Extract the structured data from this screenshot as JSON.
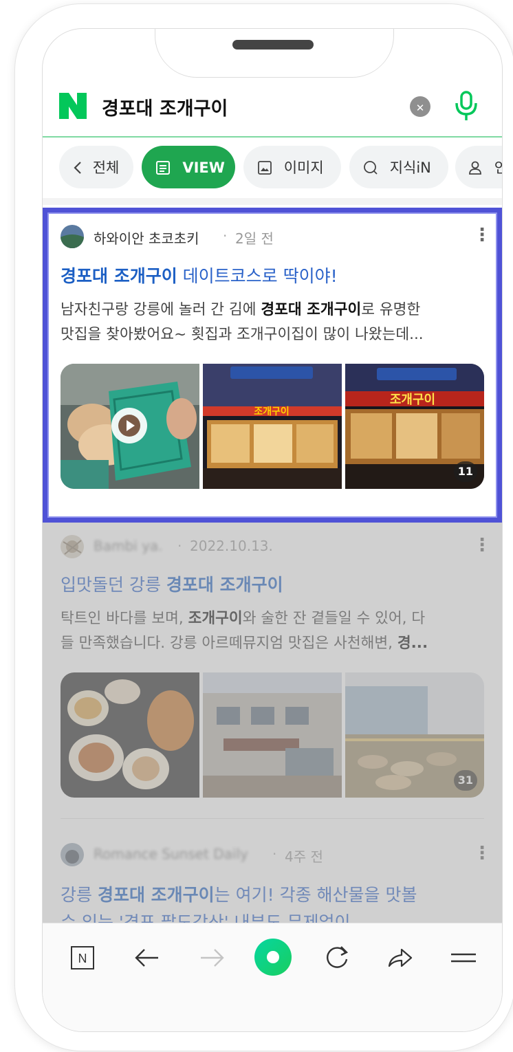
{
  "search": {
    "query": "경포대 조개구이",
    "clear_symbol": "✕"
  },
  "tabs": [
    {
      "label": "전체",
      "icon": "chevron-left-icon",
      "active": false
    },
    {
      "label": "VIEW",
      "icon": "document-icon",
      "active": true
    },
    {
      "label": "이미지",
      "icon": "image-icon",
      "active": false
    },
    {
      "label": "지식iN",
      "icon": "question-icon",
      "active": false
    },
    {
      "label": "인",
      "icon": "person-icon",
      "active": false
    }
  ],
  "results": [
    {
      "author": "하와이안 초코초키",
      "date": "2일 전",
      "title_highlight": "경포대 조개구이",
      "title_rest": " 데이트코스로 딱이야!",
      "desc_line1_a": "남자친구랑 강릉에 놀러 간 김에 ",
      "desc_line1_b": "경포대 조개구이",
      "desc_line1_c": "로 유명한",
      "desc_line2": "맛집을 찾아봤어요~ 횟집과 조개구이집이 많이 나왔는데...",
      "image_count": "11",
      "sign1": "조개구이",
      "sign2": "조개구이"
    },
    {
      "author": "Bambi ya.",
      "date": "2022.10.13.",
      "title_rest": "입맛돌던 강릉 ",
      "title_highlight": "경포대 조개구이",
      "desc_line1_a": "탁트인 바다를 보며, ",
      "desc_line1_b": "조개구이",
      "desc_line1_c": "와 술한 잔 곁들일 수 있어, 다",
      "desc_line2_a": "들 만족했습니다. 강릉 아르떼뮤지엄 맛집은 사천해변, ",
      "desc_line2_b": "경...",
      "image_count": "31"
    },
    {
      "author": "Romance Sunset Daily",
      "date": "4주 전",
      "title_rest": "강릉 ",
      "title_highlight": "경포대 조개구이",
      "title_tail": "는 여기! 각종 해산물을 맛볼",
      "title_line2": "수 있는 '경포 팔도강산' 내부도 무제없이"
    }
  ],
  "separator": "·",
  "more_symbol": "⋮",
  "toolbar": {
    "home_label": "N"
  },
  "colors": {
    "naver_green": "#03c75a",
    "highlight_border": "#4f52d6",
    "title_blue": "#1c5fc4"
  }
}
